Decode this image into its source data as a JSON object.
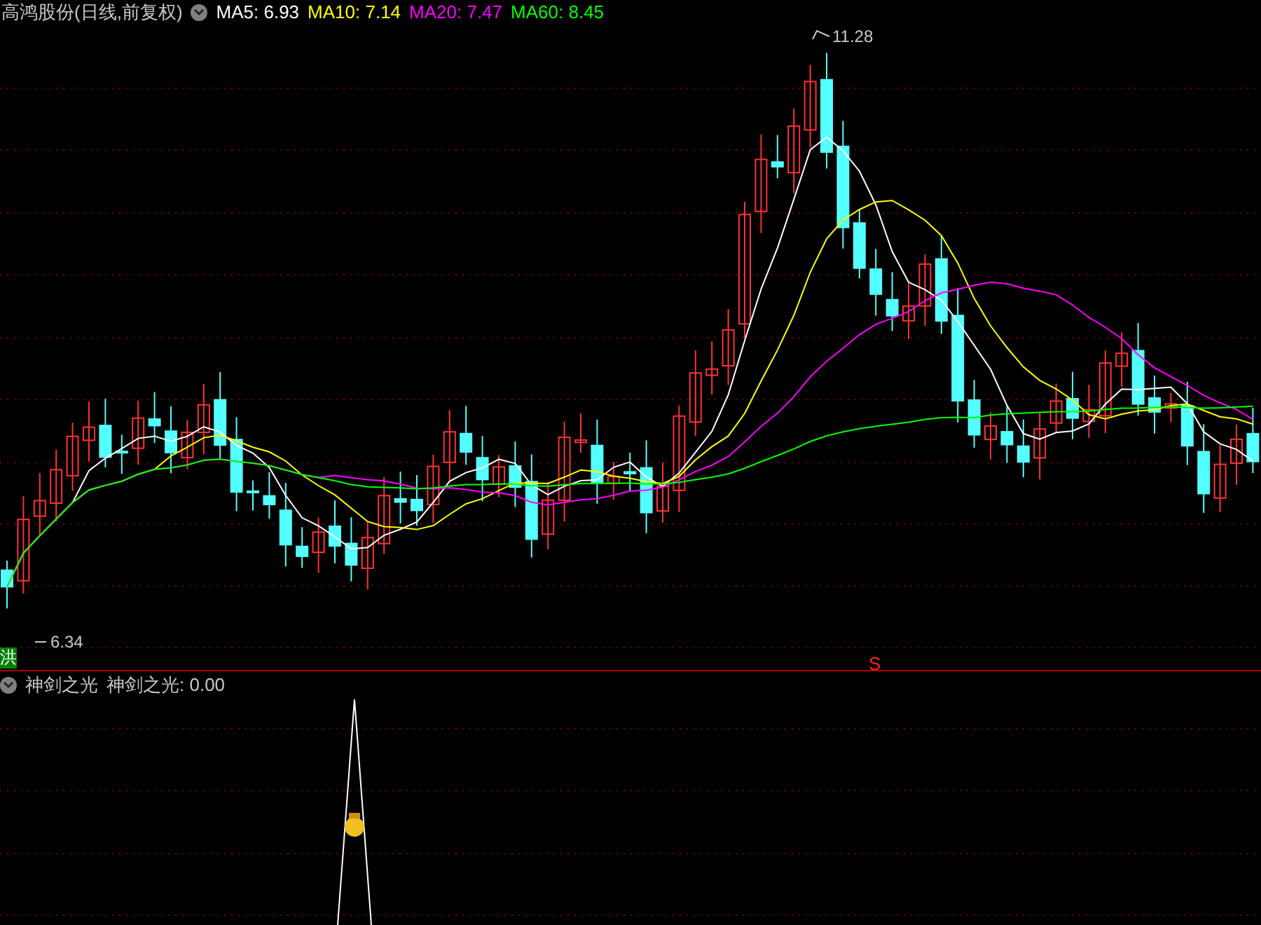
{
  "header": {
    "stock": "高鸿股份(日线,前复权)",
    "moving_averages": [
      {
        "label": "MA5: 6.93",
        "color": "#ffffff"
      },
      {
        "label": "MA10: 7.14",
        "color": "#ffff00"
      },
      {
        "label": "MA20: 7.47",
        "color": "#ff00ff"
      },
      {
        "label": "MA60: 8.45",
        "color": "#00ff00"
      }
    ]
  },
  "chart": {
    "high_label": "11.28",
    "low_label": "6.34",
    "buy_marker": "洪",
    "sell_marker": "S"
  },
  "indicator": {
    "name": "神剑之光",
    "value_label": "神剑之光: 0.00"
  }
}
